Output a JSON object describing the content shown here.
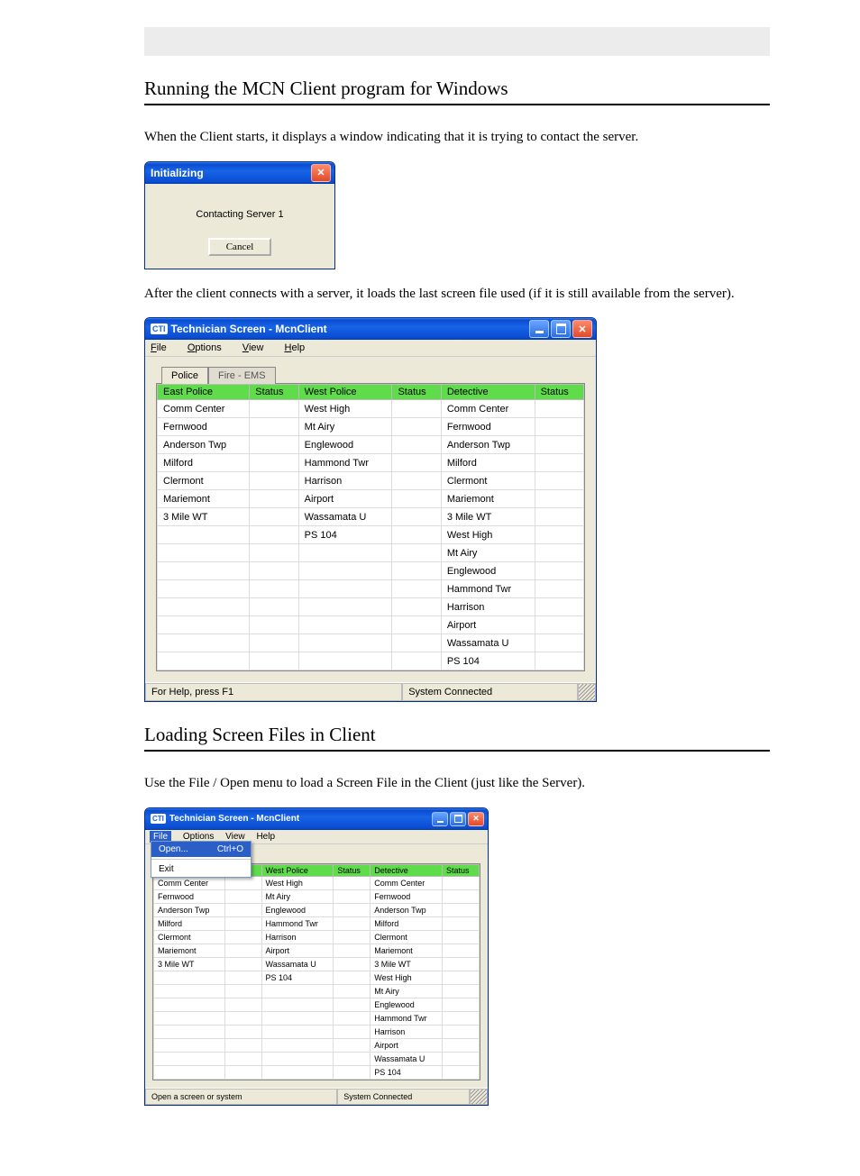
{
  "section1_title": "Running the MCN Client program for Windows",
  "section2_title": "Loading Screen Files in Client",
  "para_intro": "When the Client starts, it displays a window indicating that it is trying to contact the server.",
  "para_after_dlg": "After the client connects with a server, it loads the last screen file used (if it is still available from the server).",
  "para_section2": "Use the File / Open menu to load a Screen File in the Client (just like the Server).",
  "dlg": {
    "title": "Initializing",
    "msg": "Contacting Server 1",
    "cancel": "Cancel"
  },
  "app_title": "Technician Screen - McnClient",
  "menu": {
    "file": "File",
    "options": "Options",
    "view": "View",
    "help": "Help"
  },
  "tabs": {
    "active": "Police",
    "inactive": "Fire - EMS"
  },
  "cols": {
    "c1": "East Police",
    "c2": "Status",
    "c3": "West Police",
    "c4": "Status",
    "c5": "Detective",
    "c6": "Status"
  },
  "rows_east": [
    "Comm Center",
    "Fernwood",
    "Anderson Twp",
    "Milford",
    "Clermont",
    "Mariemont",
    "3 Mile WT",
    "",
    "",
    "",
    "",
    "",
    "",
    "",
    ""
  ],
  "rows_west": [
    "West High",
    "Mt Airy",
    "Englewood",
    "Hammond Twr",
    "Harrison",
    "Airport",
    "Wassamata U",
    "PS 104",
    "",
    "",
    "",
    "",
    "",
    "",
    ""
  ],
  "rows_det": [
    "Comm Center",
    "Fernwood",
    "Anderson Twp",
    "Milford",
    "Clermont",
    "Mariemont",
    "3 Mile WT",
    "West High",
    "Mt Airy",
    "Englewood",
    "Hammond Twr",
    "Harrison",
    "Airport",
    "Wassamata U",
    "PS 104"
  ],
  "status": {
    "help": "For Help, press F1",
    "conn": "System Connected",
    "open_hint": "Open a screen or system"
  },
  "filemenu": {
    "open": "Open...",
    "open_sc": "Ctrl+O",
    "exit": "Exit"
  }
}
